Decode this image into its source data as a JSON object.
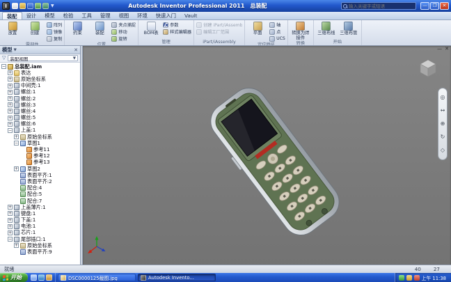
{
  "colors": {
    "titlebar_blue": "#2258cc",
    "taskbar_blue": "#2258cc",
    "start_green": "#3a9430",
    "viewport_gray": "#7b7b7b",
    "screen_dark": "#15151d",
    "accent_red_strip": "#b32c22"
  },
  "window": {
    "app_title": "Autodesk Inventor Professional 2011",
    "doc_name": "总装配",
    "search_placeholder": "输入关键字或短语",
    "controls": {
      "minimize": "—",
      "maximize": "❐",
      "close": "✕"
    }
  },
  "quick_access": [
    "new",
    "open",
    "save",
    "undo",
    "redo"
  ],
  "ribbon": {
    "active_tab": "装配",
    "tabs": [
      "装配",
      "设计",
      "模型",
      "检验",
      "工具",
      "管理",
      "视图",
      "环境",
      "快速入门",
      "Vault"
    ],
    "panels": [
      {
        "label": "零部件",
        "large": [
          {
            "label": "放置",
            "icon": "place"
          },
          {
            "label": "创建",
            "icon": "create"
          }
        ],
        "small": [
          {
            "label": "阵列",
            "icon": "pattern"
          },
          {
            "label": "镜像",
            "icon": "mirror"
          },
          {
            "label": "复制",
            "icon": "copy"
          }
        ]
      },
      {
        "label": "位置",
        "large": [
          {
            "label": "约束",
            "icon": "constrain"
          },
          {
            "label": "装配",
            "icon": "assemble"
          }
        ],
        "small": [
          {
            "label": "夹点捕捉",
            "icon": "gripsnap"
          },
          {
            "label": "移动",
            "icon": "move"
          },
          {
            "label": "旋转",
            "icon": "rotate"
          }
        ]
      },
      {
        "label": "管理",
        "large": [
          {
            "label": "BOM表",
            "icon": "bom"
          }
        ],
        "small": [
          {
            "label": "参数",
            "icon": "fx"
          },
          {
            "label": "样式编辑器",
            "icon": "styles"
          }
        ]
      },
      {
        "label": "iPart/iAssembly",
        "large": [],
        "small": [
          {
            "label": "创建 iPart/iAssembly",
            "icon": "ipart",
            "disabled": true
          },
          {
            "label": "编辑工厂范围",
            "icon": "factory",
            "disabled": true
          }
        ]
      },
      {
        "label": "定位特征",
        "large": [
          {
            "label": "平面",
            "icon": "plane"
          }
        ],
        "small": [
          {
            "label": "轴",
            "icon": "axis"
          },
          {
            "label": "点",
            "icon": "point"
          },
          {
            "label": "UCS",
            "icon": "ucs"
          }
        ]
      },
      {
        "label": "转换",
        "large": [
          {
            "label": "转换为焊接件",
            "icon": "weld"
          }
        ],
        "small": []
      },
      {
        "label": "开始",
        "large": [
          {
            "label": "三维布线",
            "icon": "harness"
          },
          {
            "label": "三维布管",
            "icon": "pipe"
          }
        ],
        "small": []
      }
    ]
  },
  "browser": {
    "title": "模型",
    "close_glyph": "✕",
    "toolbar": {
      "filter_glyph": "▽",
      "view_dropdown": "装配视图"
    },
    "tree": [
      {
        "label": "总装配.iam",
        "level": 0,
        "icon": "assembly",
        "expand": "minus",
        "bold": true
      },
      {
        "label": "表达",
        "level": 1,
        "icon": "folder",
        "expand": "plus"
      },
      {
        "label": "原始坐标系",
        "level": 1,
        "icon": "origin",
        "expand": "plus"
      },
      {
        "label": "中间壳:1",
        "level": 1,
        "icon": "part",
        "expand": "plus"
      },
      {
        "label": "螺丝:1",
        "level": 1,
        "icon": "part",
        "expand": "plus"
      },
      {
        "label": "螺丝:2",
        "level": 1,
        "icon": "part",
        "expand": "plus"
      },
      {
        "label": "螺丝:3",
        "level": 1,
        "icon": "part",
        "expand": "plus"
      },
      {
        "label": "螺丝:4",
        "level": 1,
        "icon": "part",
        "expand": "plus"
      },
      {
        "label": "螺丝:5",
        "level": 1,
        "icon": "part",
        "expand": "plus"
      },
      {
        "label": "螺丝:6",
        "level": 1,
        "icon": "part",
        "expand": "plus"
      },
      {
        "label": "上盖:1",
        "level": 1,
        "icon": "part",
        "expand": "minus"
      },
      {
        "label": "原始坐标系",
        "level": 2,
        "icon": "origin",
        "expand": "plus"
      },
      {
        "label": "草图1",
        "level": 2,
        "icon": "sketch",
        "expand": "minus"
      },
      {
        "label": "参考11",
        "level": 3,
        "icon": "reference",
        "expand": ""
      },
      {
        "label": "参考12",
        "level": 3,
        "icon": "reference",
        "expand": ""
      },
      {
        "label": "参考13",
        "level": 3,
        "icon": "reference",
        "expand": ""
      },
      {
        "label": "草图2",
        "level": 2,
        "icon": "sketch",
        "expand": "plus"
      },
      {
        "label": "表面平齐:1",
        "level": 2,
        "icon": "flush",
        "expand": ""
      },
      {
        "label": "表面平齐:2",
        "level": 2,
        "icon": "flush",
        "expand": ""
      },
      {
        "label": "配合:4",
        "level": 2,
        "icon": "mate",
        "expand": ""
      },
      {
        "label": "配合:5",
        "level": 2,
        "icon": "mate",
        "expand": ""
      },
      {
        "label": "配合:7",
        "level": 2,
        "icon": "mate",
        "expand": ""
      },
      {
        "label": "上盖薄片:1",
        "level": 1,
        "icon": "part",
        "expand": "plus"
      },
      {
        "label": "键盘:1",
        "level": 1,
        "icon": "part",
        "expand": "plus"
      },
      {
        "label": "下盖:1",
        "level": 1,
        "icon": "part",
        "expand": "plus"
      },
      {
        "label": "电池:1",
        "level": 1,
        "icon": "part",
        "expand": "plus"
      },
      {
        "label": "芯片:1",
        "level": 1,
        "icon": "part",
        "expand": "plus"
      },
      {
        "label": "尾部插口:1",
        "level": 1,
        "icon": "part",
        "expand": "minus"
      },
      {
        "label": "原始坐标系",
        "level": 2,
        "icon": "origin",
        "expand": "plus"
      },
      {
        "label": "表面平齐:9",
        "level": 2,
        "icon": "flush",
        "expand": ""
      }
    ]
  },
  "viewport": {
    "doc_controls": {
      "minimize": "—",
      "close": "✕"
    },
    "nav_tools": [
      {
        "name": "full-navigation-wheel",
        "glyph": "◎"
      },
      {
        "name": "pan",
        "glyph": "↔"
      },
      {
        "name": "zoom",
        "glyph": "⊕"
      },
      {
        "name": "orbit",
        "glyph": "↻"
      },
      {
        "name": "look-at",
        "glyph": "◇"
      }
    ]
  },
  "status_bar": {
    "left_text": "就绪",
    "count_1": "40",
    "count_2": "27"
  },
  "taskbar": {
    "start_label": "开始",
    "tasks": [
      {
        "label": "DSC0000125截图.jpg",
        "icon": "image",
        "active": false
      },
      {
        "label": "Autodesk Invento...",
        "icon": "inventor",
        "active": true
      }
    ],
    "tray_time": "上午 11:38"
  }
}
